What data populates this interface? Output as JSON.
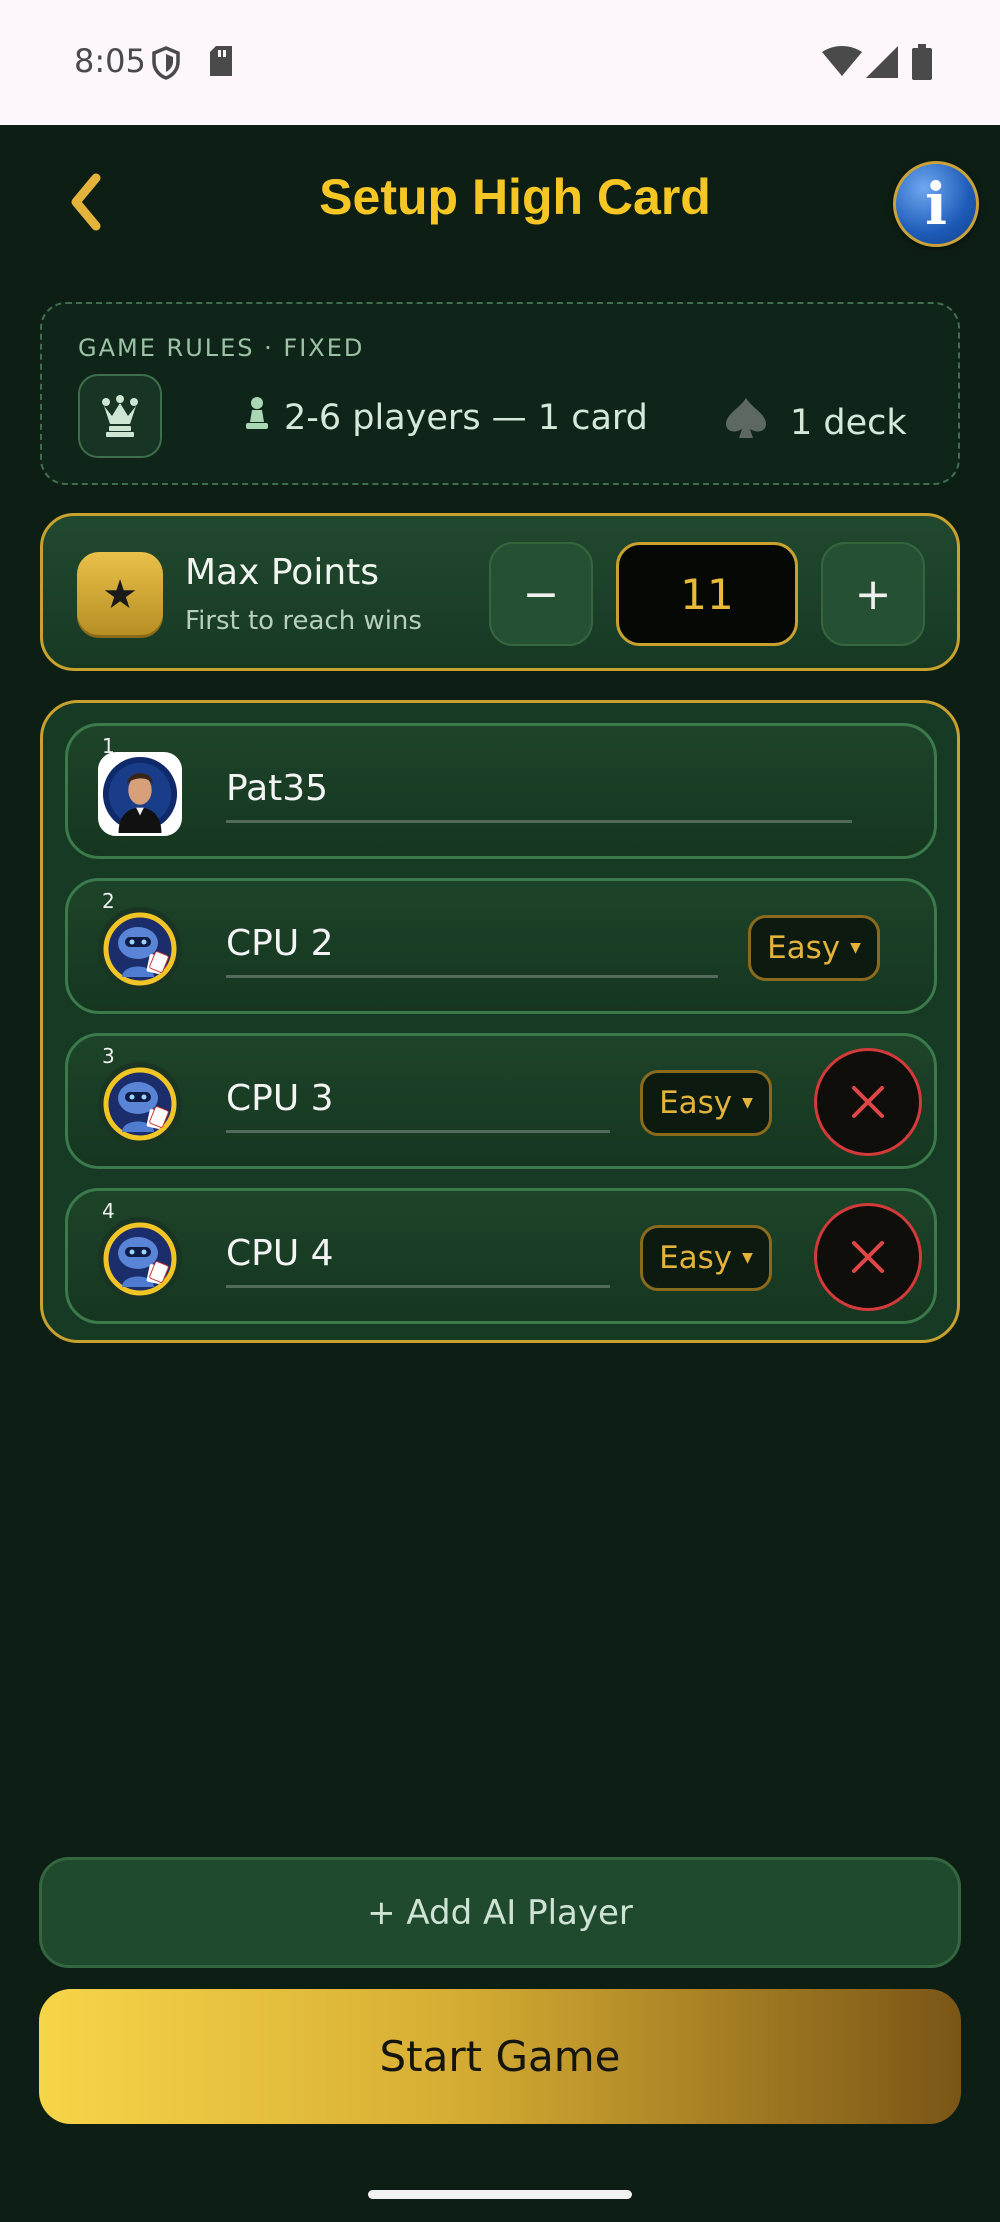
{
  "status_bar": {
    "time": "8:05",
    "icons": [
      "shield-icon",
      "sd-card-icon",
      "wifi-icon",
      "signal-icon",
      "battery-icon"
    ]
  },
  "header": {
    "back_icon": "‹",
    "title": "Setup High Card",
    "info_icon": "i"
  },
  "rules": {
    "caption": "GAME RULES · FIXED",
    "players": "2-6 players — 1 card",
    "deck": "1 deck"
  },
  "max_points": {
    "title": "Max Points",
    "subtitle": "First to reach wins",
    "minus": "−",
    "value": "11",
    "plus": "+"
  },
  "players": [
    {
      "number": "1",
      "name": "Pat35",
      "type": "human"
    },
    {
      "number": "2",
      "name": "CPU 2",
      "type": "cpu",
      "difficulty": "Easy"
    },
    {
      "number": "3",
      "name": "CPU 3",
      "type": "cpu",
      "difficulty": "Easy"
    },
    {
      "number": "4",
      "name": "CPU 4",
      "type": "cpu",
      "difficulty": "Easy"
    }
  ],
  "actions": {
    "add_ai": "+ Add AI Player",
    "start": "Start Game"
  },
  "colors": {
    "background": "#0d1f15",
    "gold": "#c9a12e",
    "title_yellow": "#f6c624",
    "danger": "#d43a3a"
  }
}
